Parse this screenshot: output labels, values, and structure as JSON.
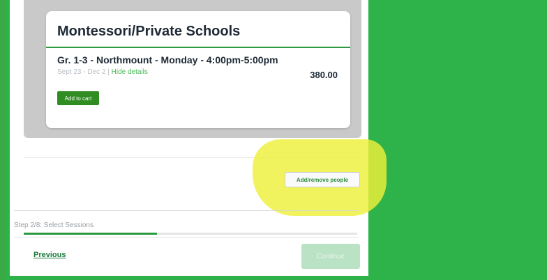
{
  "card": {
    "title": "Montessori/Private Schools",
    "session_name": "Gr. 1-3 - Northmount - Monday - 4:00pm-5:00pm",
    "dates": "Sept 23 - Dec 2",
    "separator": " | ",
    "hide_details": "Hide details",
    "price": "380.00",
    "add_to_cart_label": "Add to cart"
  },
  "people": {
    "add_remove_label": "Add/remove people"
  },
  "progress": {
    "step_label": "Step 2/8: Select Sessions",
    "fraction": 0.4
  },
  "footer": {
    "previous_label": "Previous",
    "continue_label": "Continue"
  },
  "colors": {
    "background": "#2db34a",
    "accent": "#2f8d22",
    "highlight": "#eef03a"
  }
}
